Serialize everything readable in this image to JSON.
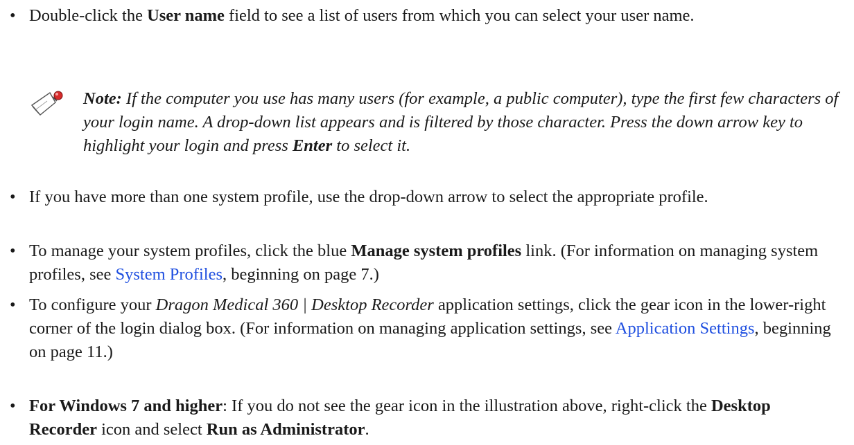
{
  "bullets": [
    {
      "pre": "Double-click the ",
      "bold": "User name",
      "post": " field to see a list of users from which you can select your user name."
    },
    {
      "text": "If you have more than one system profile, use the drop-down arrow to select the appropriate profile."
    },
    {
      "pre": "To manage your system profiles, click the blue ",
      "bold": "Manage system profiles",
      "mid": " link. (For information on managing system profiles, see ",
      "link": "System Profiles",
      "post": ", beginning on page 7.)"
    },
    {
      "pre": "To configure your ",
      "italic": "Dragon Medical 360 | Desktop Recorder",
      "mid": " application settings, click the gear icon in the lower-right corner of the login dialog box. (For information on managing application settings, see ",
      "link": "Application Settings",
      "post": ", beginning on page 11.)"
    },
    {
      "bold1": "For Windows 7 and higher",
      "mid1": ": If you do not see the gear icon in the illustration above, right-click the ",
      "bold2": "Desktop Recorder",
      "mid2": " icon and select ",
      "bold3": "Run as Administrator",
      "post": "."
    }
  ],
  "note": {
    "label": "Note:",
    "text1": " If the computer you use has many users (for example, a public computer), type the first few characters of your login name. A drop-down list appears and is filtered by those character. Press the down arrow key to highlight your login and press ",
    "bold": "Enter",
    "text2": " to select it."
  },
  "bullet_char": "•",
  "link_color": "#1f4fe0",
  "icon": "note-pin-icon"
}
